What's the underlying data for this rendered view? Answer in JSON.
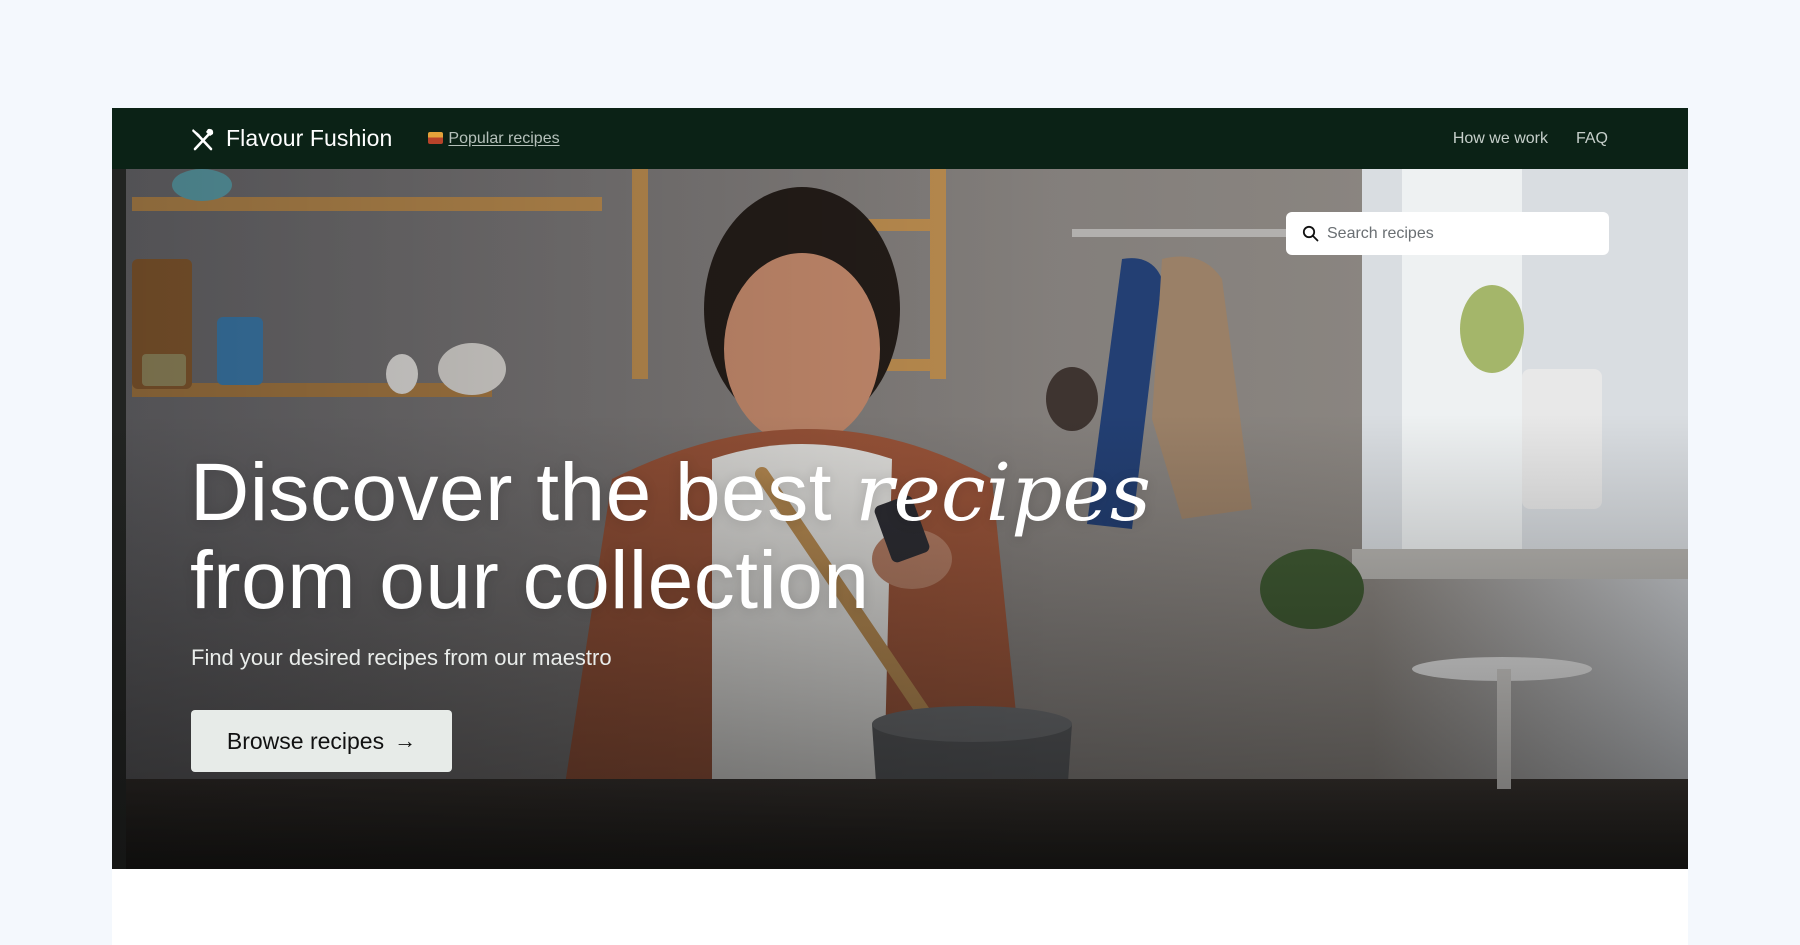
{
  "nav": {
    "brand_name": "Flavour Fushion",
    "brand_icon": "fork-knife-crossed-icon",
    "popular_label": "Popular recipes",
    "popular_icon": "pizza-emoji-icon",
    "links": [
      "How we work",
      "FAQ"
    ]
  },
  "search": {
    "placeholder": "Search recipes"
  },
  "hero": {
    "headline_part1": "Discover the best ",
    "headline_accent": "recipes",
    "headline_line2": "from our collection",
    "subtitle": "Find your desired recipes from our maestro",
    "cta_label": "Browse recipes",
    "cta_arrow": "→"
  },
  "colors": {
    "page_background": "#f4f8fd",
    "nav_background": "#0b2216",
    "cta_background": "#e7ebe8"
  }
}
